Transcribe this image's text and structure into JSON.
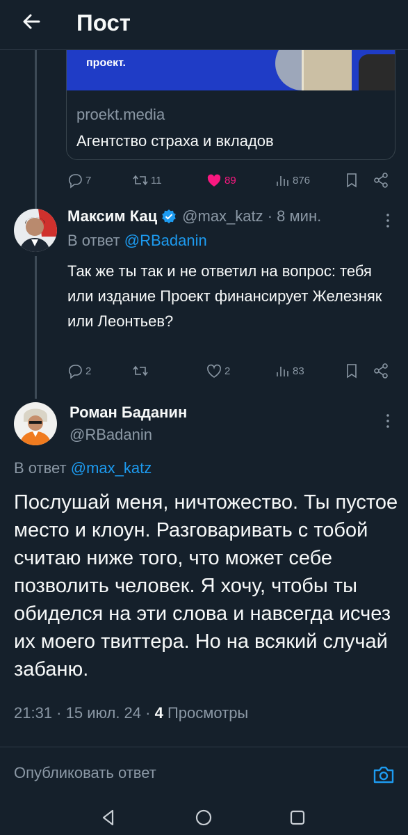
{
  "header": {
    "title": "Пост"
  },
  "card": {
    "image_logo": "проект.",
    "domain": "proekt.media",
    "title": "Агентство страха и вкладов"
  },
  "tweet1_actions": {
    "replies": "7",
    "retweets": "11",
    "likes": "89",
    "views": "876"
  },
  "tweet2": {
    "name": "Максим Кац",
    "handle": "@max_katz · 8 мин.",
    "reply_prefix": "В ответ",
    "reply_to": "@RBadanin",
    "text": "Так же ты так и не ответил на вопрос: тебя или издание Проект финансирует Железняк или Леонтьев?",
    "actions": {
      "replies": "2",
      "retweets": "",
      "likes": "2",
      "views": "83"
    }
  },
  "tweet3": {
    "name": "Роман Баданин",
    "handle": "@RBadanin",
    "reply_prefix": "В ответ",
    "reply_to": "@max_katz",
    "text": "Послушай меня, ничтожество. Ты пустое место и клоун. Разговаривать с тобой считаю ниже того, что может себе позволить человек. Я хочу, чтобы ты обиделся на эти слова и навсегда исчез их моего твиттера. Но на всякий случай забаню.",
    "time": "21:31 · 15 июл. 24 · ",
    "views_count": "4",
    "views_label": "Просмотры"
  },
  "reply_bar": {
    "placeholder": "Опубликовать ответ"
  },
  "colors": {
    "background": "#15202b",
    "accent": "#1d9bf0",
    "like": "#f91880",
    "muted": "#8b98a5"
  },
  "icons": [
    "back-arrow-icon",
    "reply-icon",
    "retweet-icon",
    "heart-icon",
    "views-icon",
    "bookmark-icon",
    "share-icon",
    "verified-icon",
    "more-icon",
    "camera-icon",
    "nav-back-icon",
    "nav-home-icon",
    "nav-recents-icon"
  ]
}
